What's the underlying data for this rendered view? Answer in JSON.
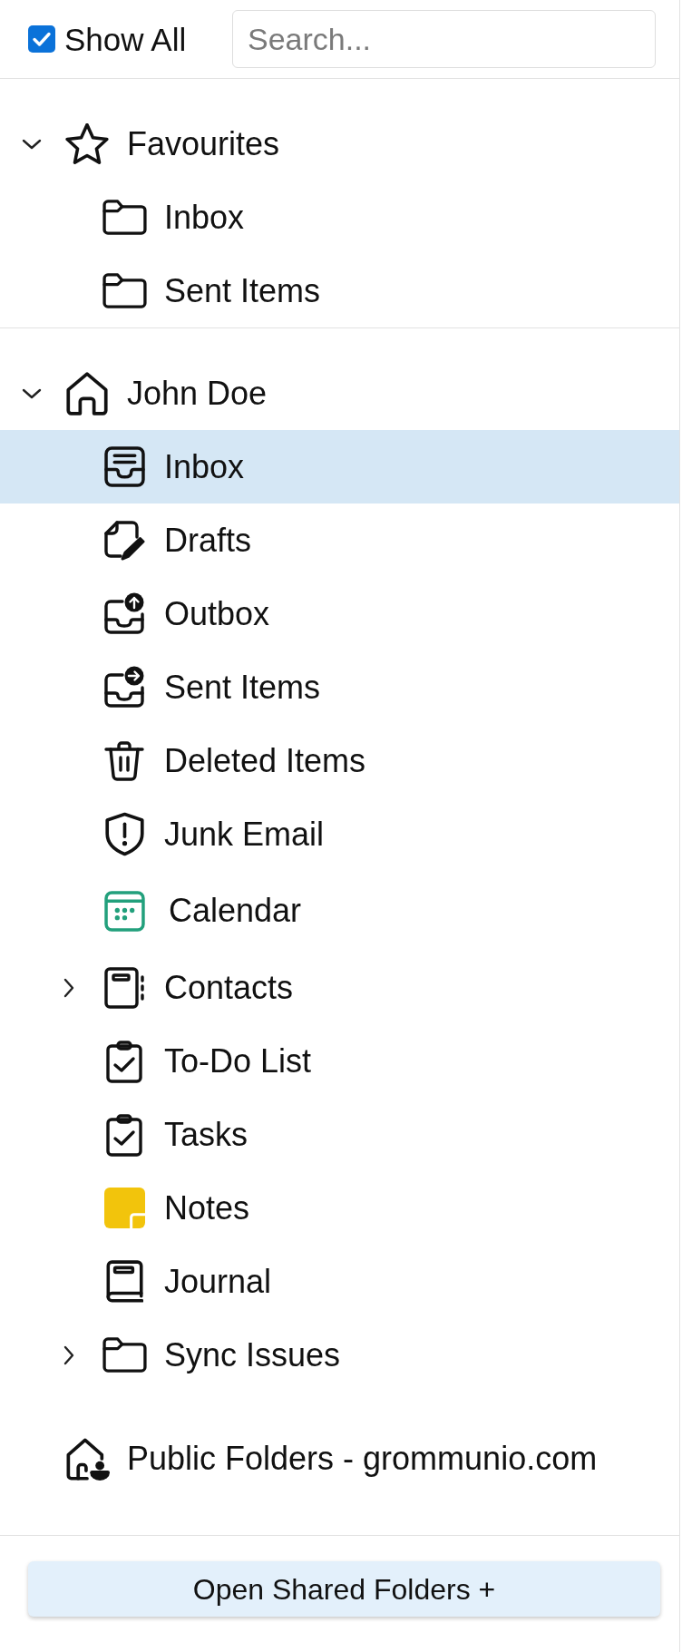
{
  "toolbar": {
    "show_all": {
      "label": "Show All",
      "checked": true
    },
    "search": {
      "placeholder": "Search..."
    }
  },
  "favourites": {
    "label": "Favourites",
    "kind": "favourites",
    "expanded": true,
    "selected": false,
    "children": [
      {
        "label": "Inbox",
        "kind": "folder",
        "selected": false
      },
      {
        "label": "Sent Items",
        "kind": "folder",
        "selected": false
      }
    ]
  },
  "stores": [
    {
      "label": "John Doe",
      "kind": "mailbox",
      "expanded": true,
      "selected": false,
      "children": [
        {
          "label": "Inbox",
          "kind": "inbox",
          "selected": true
        },
        {
          "label": "Drafts",
          "kind": "drafts",
          "selected": false
        },
        {
          "label": "Outbox",
          "kind": "outbox",
          "selected": false
        },
        {
          "label": "Sent Items",
          "kind": "sent",
          "selected": false
        },
        {
          "label": "Deleted Items",
          "kind": "trash",
          "selected": false
        },
        {
          "label": "Junk Email",
          "kind": "junk",
          "selected": false
        },
        {
          "label": "Calendar",
          "kind": "calendar",
          "selected": false
        },
        {
          "label": "Contacts",
          "kind": "contacts",
          "expanded": false,
          "selected": false
        },
        {
          "label": "To-Do List",
          "kind": "todo",
          "selected": false
        },
        {
          "label": "Tasks",
          "kind": "tasks",
          "selected": false
        },
        {
          "label": "Notes",
          "kind": "notes",
          "selected": false
        },
        {
          "label": "Journal",
          "kind": "journal",
          "selected": false
        },
        {
          "label": "Sync Issues",
          "kind": "folder",
          "expanded": false,
          "selected": false
        }
      ]
    },
    {
      "label": "Public Folders - grommunio.com",
      "kind": "public",
      "selected": false
    }
  ],
  "footer_button": "Open Shared Folders +"
}
